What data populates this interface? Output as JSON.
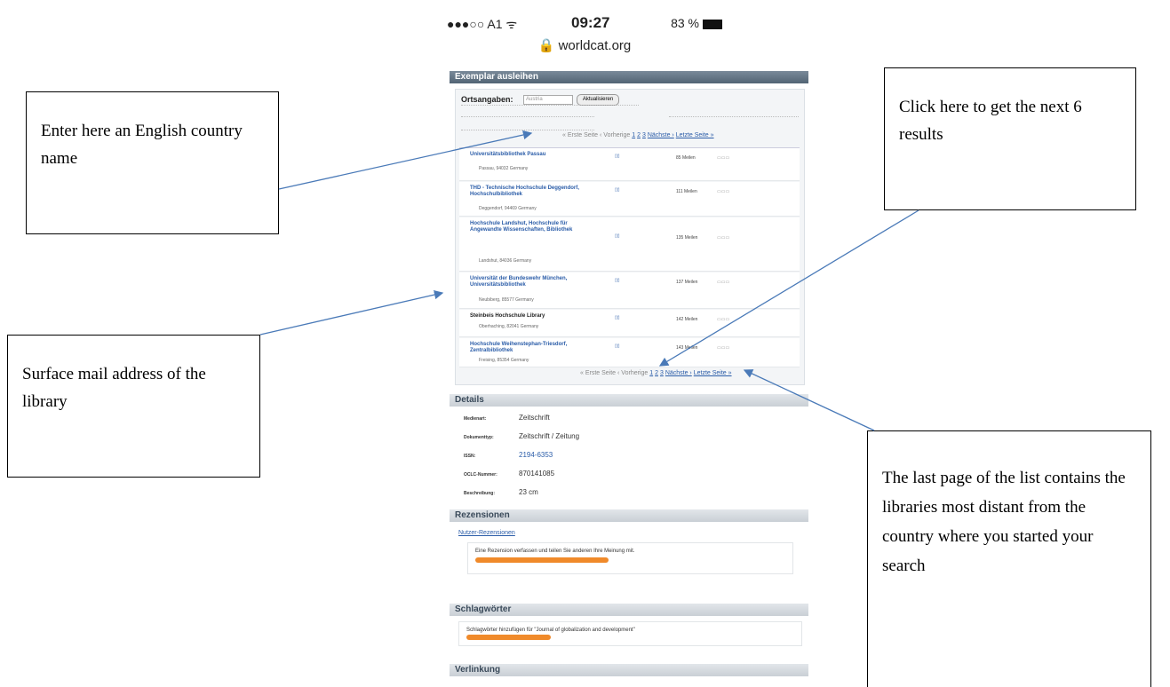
{
  "status_bar": {
    "carrier": "●●●○○ A1 ᯤ",
    "time": "09:27",
    "battery": "83 %"
  },
  "url": "🔒 worldcat.org",
  "sections": {
    "borrow": "Exemplar ausleihen",
    "details": "Details",
    "reviews": "Rezensionen",
    "keywords": "Schlagwörter",
    "links": "Verlinkung"
  },
  "location": {
    "label": "Ortsangaben:",
    "value": "Austria",
    "button": "Aktualisieren"
  },
  "libraries": [
    {
      "name": "Universitätsbibliothek Passau",
      "address": "Passau, 94032 Germany",
      "distance": "85 Meilen"
    },
    {
      "name": "THD - Technische Hochschule Deggendorf, Hochschulbibliothek",
      "address": "Deggendorf, 94469 Germany",
      "distance": "111 Meilen"
    },
    {
      "name": "Hochschule Landshut, Hochschule für Angewandte Wissenschaften, Bibliothek",
      "address": "Landshut, 84036 Germany",
      "distance": "135 Meilen"
    },
    {
      "name": "Universität der Bundeswehr München, Universitätsbibliothek",
      "address": "Neubiberg, 85577 Germany",
      "distance": "137 Meilen"
    },
    {
      "name": "Steinbeis Hochschule Library",
      "address": "Oberhaching, 82041 Germany",
      "distance": "142 Meilen"
    },
    {
      "name": "Hochschule Weihenstephan-Triesdorf, Zentralbibliothek",
      "address": "Freising, 85354 Germany",
      "distance": "143 Meilen"
    }
  ],
  "pager": {
    "first": "« Erste Seite",
    "prev": "‹ Vorherige",
    "p1": "1",
    "p2": "2",
    "p3": "3",
    "next": "Nächste ›",
    "last": "Letzte Seite »"
  },
  "details": [
    {
      "key": "Medienart:",
      "value": "Zeitschrift"
    },
    {
      "key": "Dokumenttyp:",
      "value": "Zeitschrift / Zeitung"
    },
    {
      "key": "ISSN:",
      "value": "2194-6353"
    },
    {
      "key": "OCLC-Nummer:",
      "value": "870141085"
    },
    {
      "key": "Beschreibung:",
      "value": "23 cm"
    }
  ],
  "reviews": {
    "link": "Nutzer-Rezensionen",
    "text": "Eine Rezension verfassen und teilen Sie anderen Ihre Meinung mit."
  },
  "keywords": {
    "text": "Schlagwörter hinzufügen für \"Journal of globalization and development\""
  },
  "callouts": {
    "country": "Enter here an English country name",
    "next": "Click here to get the next 6 results",
    "address": "Surface mail address of the library",
    "last": "The last page of the list contains the libraries most distant from the country where you started your search"
  },
  "colors": {
    "header_bar": "#526474",
    "link": "#2a5ca8",
    "highlight": "#f08a2a"
  }
}
